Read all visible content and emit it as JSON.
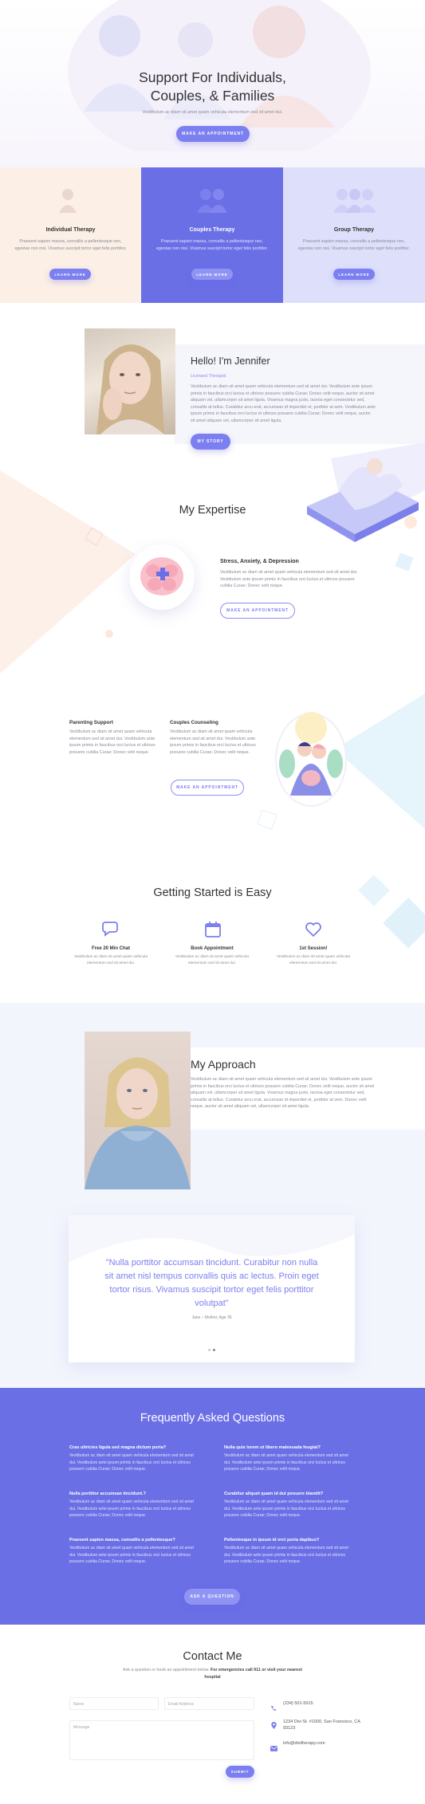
{
  "hero": {
    "title_line1": "Support For Individuals,",
    "title_line2": "Couples, & Families",
    "subtitle": "Vestibulum ac diam sit amet quam vehicula elementum sed sit amet dui.",
    "button": "MAKE AN APPOINTMENT"
  },
  "therapy": [
    {
      "title": "Individual Therapy",
      "text": "Praesent sapien massa, convallis a pellentesque nec, egestas non nisi. Vivamus suscipit tortor eget felis porttitor.",
      "button": "LEARN MORE"
    },
    {
      "title": "Couples Therapy",
      "text": "Praesent sapien massa, convallis a pellentesque nec, egestas non nisi. Vivamus suscipit tortor eget felis porttitor.",
      "button": "LEARN MORE"
    },
    {
      "title": "Group Therapy",
      "text": "Praesent sapien massa, convallis a pellentesque nec, egestas non nisi. Vivamus suscipit tortor eget felis porttitor.",
      "button": "LEARN MORE"
    }
  ],
  "about": {
    "title": "Hello! I'm Jennifer",
    "subtitle": "Licensed Therapist",
    "text": "Vestibulum ac diam sit amet quam vehicula elementum sed sit amet dui. Vestibulum ante ipsum primis in faucibus orci luctus et ultrices posuere cubilia Curae; Donec velit neque, auctor sit amet aliquam vel, ullamcorper sit amet ligula. Vivamus magna justo, lacinia eget consectetur sed, convallis at tellus. Curabitur arcu erat, accumsan id imperdiet et, porttitor at sem. Vestibulum ante ipsum primis in faucibus orci luctus et ultrices posuere cubilia Curae; Donec velit neque, auctor sit amet aliquam vel, ullamcorper sit amet ligula.",
    "button": "MY STORY"
  },
  "expertise": {
    "title": "My Expertise",
    "stress_title": "Stress, Anxiety, & Depression",
    "stress_text": "Vestibulum ac diam sit amet quam vehicula elementum sed sit amet dui. Vestibulum ante ipsum primis in faucibus orci luctus et ultrices posuere cubilia Curae; Donec velit neque.",
    "stress_button": "MAKE AN APPOINTMENT",
    "parenting_title": "Parenting Support",
    "parenting_text": "Vestibulum ac diam sit amet quam vehicula elementum sed sit amet dui. Vestibulum ante ipsum primis in faucibus orci luctus et ultrices posuere cubilia Curae; Donec velit neque.",
    "couples_title": "Couples Counseling",
    "couples_text": "Vestibulum ac diam sit amet quam vehicula elementum sed sit amet dui. Vestibulum ante ipsum primis in faucibus orci luctus et ultrices posuere cubilia Curae; Donec velit neque.",
    "couples_button": "MAKE AN APPOINTMENT"
  },
  "getting_started": {
    "title": "Getting Started is Easy",
    "steps": [
      {
        "title": "Free 20 Min Chat",
        "text": "Vestibulum ac diam sit amet quam vehicula elementum sed sit amet dui."
      },
      {
        "title": "Book Appointment",
        "text": "Vestibulum ac diam sit amet quam vehicula elementum sed sit amet dui."
      },
      {
        "title": "1st Session!",
        "text": "Vestibulum ac diam sit amet quam vehicula elementum sed sit amet dui."
      }
    ]
  },
  "approach": {
    "title": "My Approach",
    "text": "Vestibulum ac diam sit amet quam vehicula elementum sed sit amet dui. Vestibulum ante ipsum primis in faucibus orci luctus et ultrices posuere cubilia Curae; Donec velit neque, auctor sit amet aliquam vel, ullamcorper sit amet ligula. Vivamus magna justo, lacinia eget consectetur sed, convallis at tellus. Curabitur arcu erat, accumsan id imperdiet et, porttitor at sem. Donec velit neque, auctor sit amet aliquam vel, ullamcorper sit amet ligula."
  },
  "testimonial": {
    "quote": "\"Nulla porttitor accumsan tincidunt. Curabitur non nulla sit amet nisl tempus convallis quis ac lectus. Proin eget tortor risus. Vivamus suscipit tortor eget felis porttitor volutpat\"",
    "author": "Jane – Mother, Age 36"
  },
  "faq": {
    "title": "Frequently Asked Questions",
    "items": [
      {
        "q": "Cras ultricies ligula sed magna dictum porta?",
        "a": "Vestibulum ac diam sit amet quam vehicula elementum sed sit amet dui. Vestibulum ante ipsum primis in faucibus orci luctus et ultrices posuere cubilia Curae; Donec velit neque."
      },
      {
        "q": "Nulla quis lorem ut libero malesuada feugiat?",
        "a": "Vestibulum ac diam sit amet quam vehicula elementum sed sit amet dui. Vestibulum ante ipsum primis in faucibus orci luctus et ultrices posuere cubilia Curae; Donec velit neque."
      },
      {
        "q": "Nulla porttitor accumsan tincidunt.?",
        "a": "Vestibulum ac diam sit amet quam vehicula elementum sed sit amet dui. Vestibulum ante ipsum primis in faucibus orci luctus et ultrices posuere cubilia Curae; Donec velit neque."
      },
      {
        "q": "Curabitur aliquet quam id dui posuere blandit?",
        "a": "Vestibulum ac diam sit amet quam vehicula elementum sed sit amet dui. Vestibulum ante ipsum primis in faucibus orci luctus et ultrices posuere cubilia Curae; Donec velit neque."
      },
      {
        "q": "Praesent sapien massa, convallis a pellentesque?",
        "a": "Vestibulum ac diam sit amet quam vehicula elementum sed sit amet dui. Vestibulum ante ipsum primis in faucibus orci luctus et ultrices posuere cubilia Curae; Donec velit neque."
      },
      {
        "q": "Pellentesque in ipsum id orci porta dapibus?",
        "a": "Vestibulum ac diam sit amet quam vehicula elementum sed sit amet dui. Vestibulum ante ipsum primis in faucibus orci luctus et ultrices posuere cubilia Curae; Donec velit neque."
      }
    ],
    "button": "ASK A QUESTION"
  },
  "contact": {
    "title": "Contact Me",
    "intro": "Ask a question or book an appointment below.",
    "intro_bold": "For emergencies call 911 or visit your nearest hospital",
    "name_placeholder": "Name",
    "email_placeholder": "Email Address",
    "message_placeholder": "Message",
    "submit": "SUBMIT",
    "phone": "(234) 501-5915",
    "address": "1234 Divi St. #1000, San Francisco, CA 93123",
    "email": "info@divitherapy.com"
  },
  "colors": {
    "accent": "#6b6fe6",
    "accent_light": "#8a8ef3",
    "peach": "#fdeee4"
  }
}
